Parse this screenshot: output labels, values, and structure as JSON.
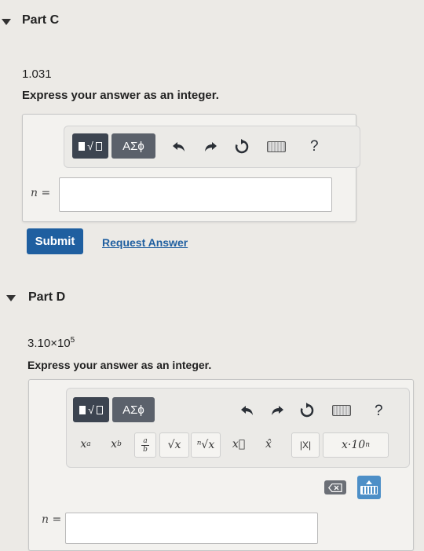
{
  "part_c": {
    "heading": "Part C",
    "value": "1.031",
    "instruction": "Express your answer as an integer.",
    "symbols_button": "ΑΣϕ",
    "variable_label": "n =",
    "answer_value": "",
    "submit_label": "Submit",
    "request_answer_label": "Request Answer",
    "help_label": "?"
  },
  "part_d": {
    "heading": "Part D",
    "value_mantissa": "3.10×10",
    "value_exponent": "5",
    "instruction": "Express your answer as an integer.",
    "symbols_button": "ΑΣϕ",
    "help_label": "?",
    "variable_label": "n =",
    "answer_value": "",
    "templates": [
      {
        "name": "superscript",
        "text": "x",
        "sup": "a"
      },
      {
        "name": "subscript",
        "text": "x",
        "sub": "b"
      },
      {
        "name": "fraction",
        "num": "a",
        "den": "b"
      },
      {
        "name": "square-root",
        "text": "√x"
      },
      {
        "name": "nth-root",
        "text": "ⁿ√x"
      },
      {
        "name": "vector",
        "text": "x⃗"
      },
      {
        "name": "unit-vector",
        "text": "x̂"
      },
      {
        "name": "absolute-value",
        "text": "|X|"
      },
      {
        "name": "scientific-notation",
        "text": "x·10",
        "sup": "n"
      }
    ]
  },
  "icons": [
    "undo-icon",
    "redo-icon",
    "reset-icon",
    "keyboard-icon",
    "delete-icon",
    "keyboard-toggle-icon"
  ]
}
